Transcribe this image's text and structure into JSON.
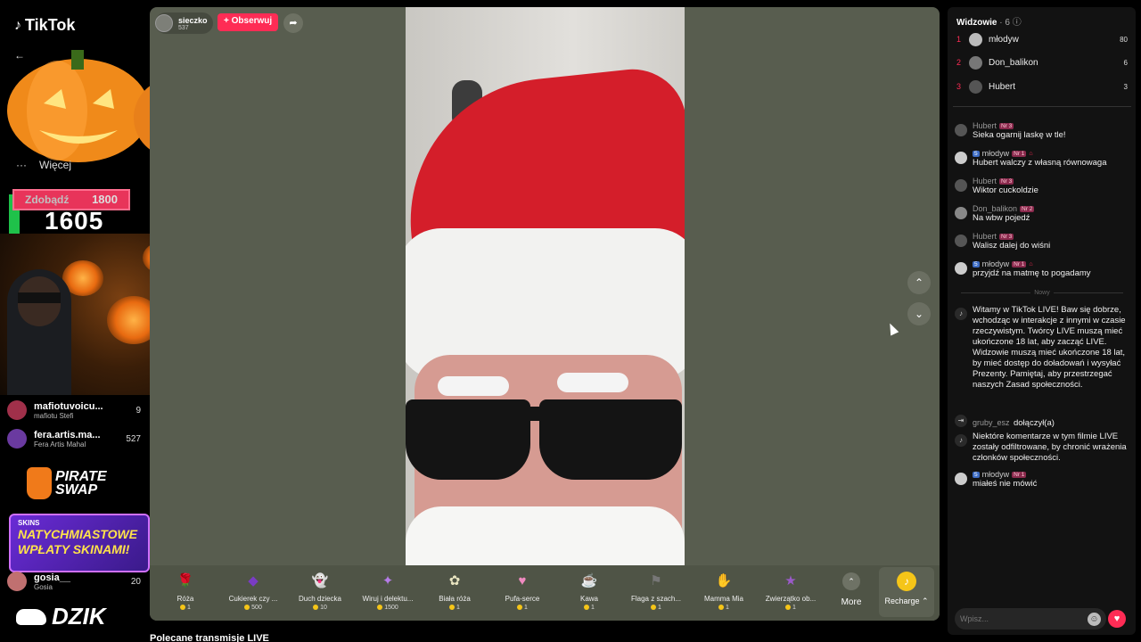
{
  "left_panel": {
    "logo_text": "TikTok",
    "logo_glyph": "♪",
    "back_icon": "arrow-left-icon",
    "more_label": "Więcej",
    "more_dots": "···",
    "goal_label": "Zdobądź",
    "goal_target": "1800",
    "goal_current": "1605",
    "viewers": [
      {
        "name": "mafiotuvoicu...",
        "sub": "mafiotu Stefi",
        "value": "9"
      },
      {
        "name": "fera.artis.ma...",
        "sub": "Fera Artis Mahal",
        "value": "527"
      },
      {
        "name": "gosia__",
        "sub": "Gosia",
        "value": "20"
      }
    ],
    "pirate_line1": "PIRATE",
    "pirate_line2": "SWAP",
    "skins_brand": "SKINS",
    "skins_line1": "NATYCHMIASTOWE",
    "skins_line2": "WPŁATY SKINAMI!",
    "dzik_text": "DZIK"
  },
  "stream": {
    "host_name": "sieczko",
    "host_likes": "537",
    "follow_label": "+ Obserwuj",
    "share_icon": "➦",
    "up_icon": "⌃",
    "down_icon": "⌄",
    "gifts": [
      {
        "name": "Róża",
        "price": "1",
        "icon": "🌹",
        "color": "#c81e3a"
      },
      {
        "name": "Cukierek czy ...",
        "price": "500",
        "icon": "◆",
        "color": "#7a3cc4"
      },
      {
        "name": "Duch dziecka",
        "price": "10",
        "icon": "👻",
        "color": "#9aa0b0"
      },
      {
        "name": "Wiruj i delektu...",
        "price": "1500",
        "icon": "✦",
        "color": "#b67ce8"
      },
      {
        "name": "Biała róża",
        "price": "1",
        "icon": "✿",
        "color": "#e8e4c0"
      },
      {
        "name": "Pufa-serce",
        "price": "1",
        "icon": "♥",
        "color": "#f08ac0"
      },
      {
        "name": "Kawa",
        "price": "1",
        "icon": "☕",
        "color": "#6a3a1a"
      },
      {
        "name": "Flaga z szach...",
        "price": "1",
        "icon": "⚑",
        "color": "#777"
      },
      {
        "name": "Mamma Mia",
        "price": "1",
        "icon": "✋",
        "color": "#e8a080"
      },
      {
        "name": "Zwierzątko ob...",
        "price": "1",
        "icon": "★",
        "color": "#9a5ac8"
      }
    ],
    "more_label": "More",
    "more_icon": "⌃",
    "recharge_label": "Recharge ⌃",
    "recharge_icon": "♪"
  },
  "recommended_label": "Polecane transmisje LIVE",
  "right_panel": {
    "viewers_title": "Widzowie",
    "viewers_count": "· 6 ⓘ",
    "top_viewers": [
      {
        "rank": "1",
        "name": "młodyw",
        "score": "80"
      },
      {
        "rank": "2",
        "name": "Don_balikon",
        "score": "6"
      },
      {
        "rank": "3",
        "name": "Hubert",
        "score": "3"
      }
    ],
    "messages": [
      {
        "user": "Hubert",
        "nr": "Nr 3",
        "lvl": "",
        "text": "Sieka ogarnij laskę w tle!"
      },
      {
        "user": "młodyw",
        "nr": "Nr 1",
        "lvl": "5",
        "text": "Hubert walczy z własną równowaga"
      },
      {
        "user": "Hubert",
        "nr": "Nr 3",
        "lvl": "",
        "text": "Wiktor cuckoldzie"
      },
      {
        "user": "Don_balikon",
        "nr": "Nr 2",
        "lvl": "",
        "text": "Na wbw pojedź"
      },
      {
        "user": "Hubert",
        "nr": "Nr 3",
        "lvl": "",
        "text": "Walisz dalej do wiśni"
      },
      {
        "user": "młodyw",
        "nr": "Nr 1",
        "lvl": "5",
        "text": "przyjdź na matmę to pogadamy"
      }
    ],
    "new_label": "Nowy",
    "system_welcome": "Witamy w TikTok LIVE! Baw się dobrze, wchodząc w interakcje z innymi w czasie rzeczywistym. Twórcy LIVE muszą mieć ukończone 18 lat, aby zacząć LIVE. Widzowie muszą mieć ukończone 18 lat, by mieć dostęp do doładowań i wysyłać Prezenty. Pamiętaj, aby przestrzegać naszych Zasad społeczności.",
    "joined_user": "gruby_esz",
    "joined_action": "dołączył(a)",
    "system_filter": "Niektóre komentarze w tym filmie LIVE zostały odfiltrowane, by chronić wrażenia członków społeczności.",
    "last_message": {
      "user": "młodyw",
      "nr": "Nr 1",
      "lvl": "5",
      "text": "miałeś nie mówić"
    },
    "comment_placeholder": "Wpisz...",
    "emoji_icon": "☺",
    "like_icon": "♥"
  }
}
